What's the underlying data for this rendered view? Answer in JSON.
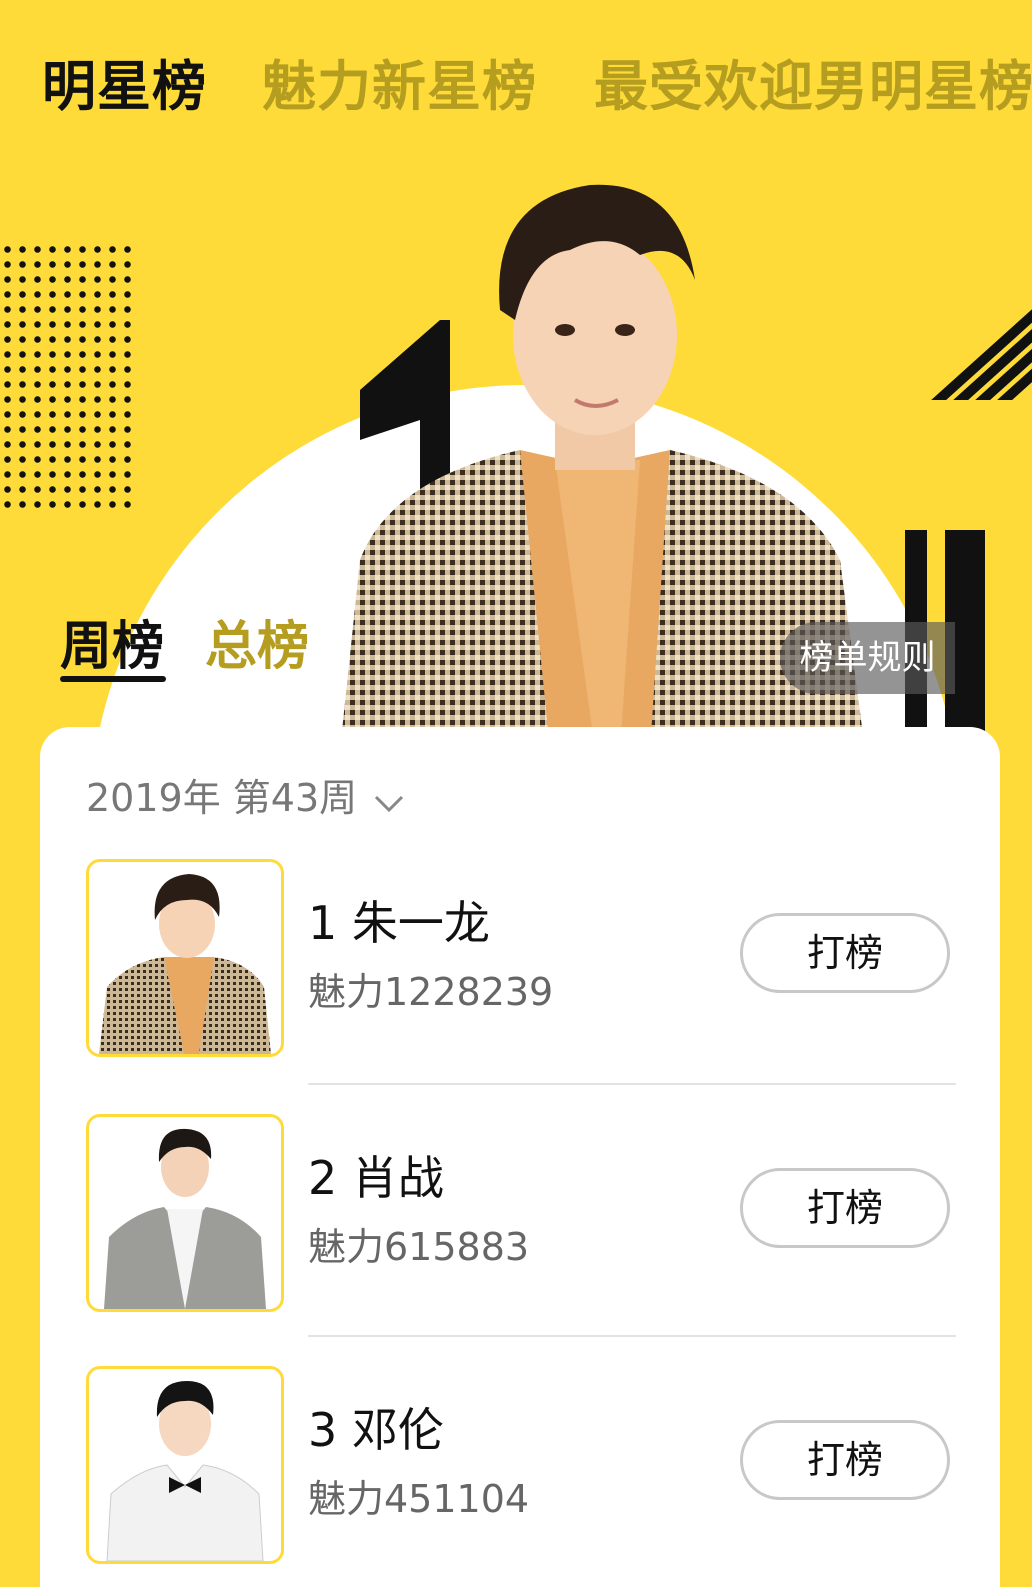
{
  "top_tabs": [
    "明星榜",
    "魅力新星榜",
    "最受欢迎男明星榜"
  ],
  "sub_tabs": [
    "周榜",
    "总榜"
  ],
  "rules_label": "榜单规则",
  "week_label": "2019年 第43周",
  "colors": {
    "accent": "#ffdb3a",
    "inactive_tab": "#b59d20"
  },
  "rankings": [
    {
      "rank_name": "1 朱一龙",
      "charm": "魅力1228239",
      "vote": "打榜"
    },
    {
      "rank_name": "2 肖战",
      "charm": "魅力615883",
      "vote": "打榜"
    },
    {
      "rank_name": "3 邓伦",
      "charm": "魅力451104",
      "vote": "打榜"
    }
  ]
}
